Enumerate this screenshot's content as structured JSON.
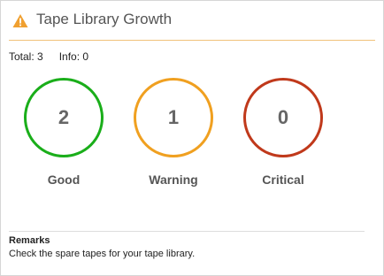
{
  "widget": {
    "title": "Tape Library Growth",
    "title_icon": "warning-triangle-icon",
    "accent_color": "#f0a030"
  },
  "summary": {
    "total_label": "Total: 3",
    "info_label": "Info: 0"
  },
  "stats": [
    {
      "value": "2",
      "label": "Good",
      "color": "#1aae1a"
    },
    {
      "value": "1",
      "label": "Warning",
      "color": "#f0a020"
    },
    {
      "value": "0",
      "label": "Critical",
      "color": "#c0391b"
    }
  ],
  "remarks": {
    "title": "Remarks",
    "text": "Check the spare tapes for your tape library."
  }
}
